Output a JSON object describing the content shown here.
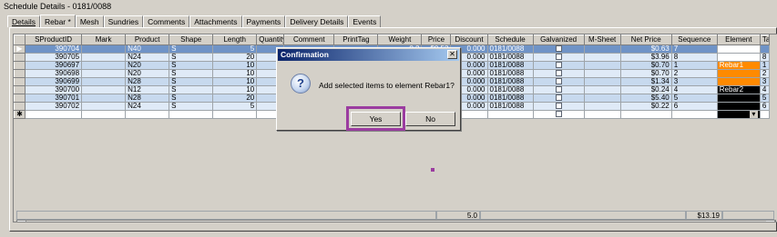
{
  "window": {
    "title": "Schedule Details - 0181/0088"
  },
  "tabs": [
    {
      "label": "Details"
    },
    {
      "label": "Rebar *"
    },
    {
      "label": "Mesh"
    },
    {
      "label": "Sundries"
    },
    {
      "label": "Comments"
    },
    {
      "label": "Attachments"
    },
    {
      "label": "Payments"
    },
    {
      "label": "Delivery Details"
    },
    {
      "label": "Events"
    }
  ],
  "grid": {
    "columns": [
      "SProductID",
      "Mark",
      "Product",
      "Shape",
      "Length",
      "Quantity",
      "Comment",
      "PrintTag",
      "Weight",
      "Price",
      "Discount",
      "Schedule",
      "Galvanized",
      "M-Sheet",
      "Net Price",
      "Sequence",
      "Element",
      "Ta"
    ],
    "rows": [
      {
        "id": "390704",
        "mark": "",
        "product": "N40",
        "shape": "S",
        "length": "5",
        "qty": "",
        "comment": "",
        "weight": "0.2",
        "price": "$0.53",
        "discount": "0.000",
        "schedule": "0181/0088",
        "net": "$0.63",
        "seq": "7",
        "element": "",
        "element_style": "white",
        "ta": "",
        "row_marker": "▶"
      },
      {
        "id": "390705",
        "mark": "",
        "product": "N24",
        "shape": "S",
        "length": "20",
        "qty": "2",
        "comment": "",
        "weight": "",
        "price": "",
        "discount": "0.000",
        "schedule": "0181/0088",
        "net": "$3.96",
        "seq": "8",
        "element": "",
        "element_style": "white",
        "ta": "8",
        "row_marker": ""
      },
      {
        "id": "390697",
        "mark": "",
        "product": "N20",
        "shape": "S",
        "length": "10",
        "qty": "1",
        "comment": "",
        "weight": "",
        "price": "",
        "discount": "0.000",
        "schedule": "0181/0088",
        "net": "$0.70",
        "seq": "1",
        "element": "Rebar1",
        "element_style": "orange",
        "ta": "1",
        "row_marker": ""
      },
      {
        "id": "390698",
        "mark": "",
        "product": "N20",
        "shape": "S",
        "length": "10",
        "qty": "1",
        "comment": "",
        "weight": "",
        "price": "",
        "discount": "0.000",
        "schedule": "0181/0088",
        "net": "$0.70",
        "seq": "2",
        "element": "",
        "element_style": "orange",
        "ta": "2",
        "row_marker": ""
      },
      {
        "id": "390699",
        "mark": "",
        "product": "N28",
        "shape": "S",
        "length": "10",
        "qty": "1",
        "comment": "",
        "weight": "",
        "price": "",
        "discount": "0.000",
        "schedule": "0181/0088",
        "net": "$1.34",
        "seq": "3",
        "element": "",
        "element_style": "orange",
        "ta": "3",
        "row_marker": ""
      },
      {
        "id": "390700",
        "mark": "",
        "product": "N12",
        "shape": "S",
        "length": "10",
        "qty": "1",
        "comment": "",
        "weight": "",
        "price": "",
        "discount": "0.000",
        "schedule": "0181/0088",
        "net": "$0.24",
        "seq": "4",
        "element": "Rebar2",
        "element_style": "black",
        "ta": "4",
        "row_marker": ""
      },
      {
        "id": "390701",
        "mark": "",
        "product": "N28",
        "shape": "S",
        "length": "20",
        "qty": "2",
        "comment": "",
        "weight": "",
        "price": "",
        "discount": "0.000",
        "schedule": "0181/0088",
        "net": "$5.40",
        "seq": "5",
        "element": "",
        "element_style": "black",
        "ta": "5",
        "row_marker": ""
      },
      {
        "id": "390702",
        "mark": "",
        "product": "N24",
        "shape": "S",
        "length": "5",
        "qty": "",
        "comment": "",
        "weight": "",
        "price": "",
        "discount": "0.000",
        "schedule": "0181/0088",
        "net": "$0.22",
        "seq": "6",
        "element": "",
        "element_style": "black",
        "ta": "6",
        "row_marker": ""
      }
    ],
    "new_row_marker": "✱",
    "totals": {
      "weight": "5.0",
      "net_price": "$13.19"
    }
  },
  "dialog": {
    "title": "Confirmation",
    "icon": "question-icon",
    "icon_glyph": "?",
    "message": "Add selected items to element Rebar1?",
    "yes_label": "Yes",
    "no_label": "No",
    "close_glyph": "✕"
  },
  "colors": {
    "selected_row": "#6f93c6",
    "row": "#c7d9ee",
    "highlight": "#9b3ca0",
    "rebar1": "#ff8a00",
    "rebar2": "#000000"
  }
}
